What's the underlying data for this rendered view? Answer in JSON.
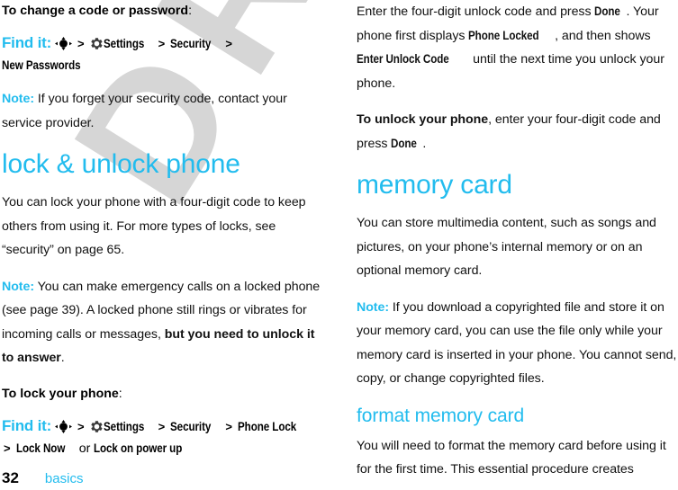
{
  "page": {
    "number": "32",
    "chapter": "basics",
    "watermark": "DRAFT",
    "accent_color": "#22bcee",
    "watermark_color": "#d6d6d6"
  },
  "icons": {
    "nav_key": "navigation-key-icon",
    "settings_gear": "gear-icon"
  },
  "left_column": {
    "lead_change_code": {
      "text": "To change a code or password",
      "punct": ":"
    },
    "find_it_1": {
      "label": "Find it:",
      "sep": ">",
      "items": [
        "Settings",
        "Security",
        "New Passwords"
      ]
    },
    "note_1": {
      "label": "Note:",
      "text": " If you forget your security code, contact your service provider."
    },
    "section_heading": "lock & unlock phone",
    "para_1": "You can lock your phone with a four-digit code to keep others from using it. For more types of locks, see “security” on page 65.",
    "note_2": {
      "label": "Note:",
      "text_1": " You can make emergency calls on a locked phone (see page 39). A locked phone still rings or vibrates for incoming calls or messages, ",
      "bold": "but you need to unlock it to answer",
      "text_2": "."
    },
    "lead_lock_phone": {
      "text": "To lock your phone",
      "punct": ":"
    },
    "find_it_2": {
      "label": "Find it:",
      "sep": ">",
      "items": [
        "Settings",
        "Security",
        "Phone Lock",
        "Lock Now"
      ],
      "or_text": "or ",
      "or_item": "Lock on power up"
    }
  },
  "right_column": {
    "para_enter_code": {
      "t1": "Enter the four-digit unlock code and press ",
      "ui1": "Done",
      "t2": ". Your phone first displays ",
      "ui2": "Phone Locked",
      "t3": ", and then shows ",
      "ui3": "Enter Unlock Code",
      "t4": " until the next time you unlock your phone."
    },
    "para_unlock": {
      "bold": "To unlock your phone",
      "t1": ", enter your four-digit code and press ",
      "ui1": "Done",
      "t2": "."
    },
    "section_heading": "memory card",
    "para_store": "You can store multimedia content, such as songs and pictures, on your phone’s internal memory or on an optional memory card.",
    "note_copyright": {
      "label": "Note:",
      "text": " If you download a copyrighted file and store it on your memory card, you can use the file only while your memory card is inserted in your phone. You cannot send, copy, or change copyrighted files."
    },
    "subsection_heading": "format memory card",
    "para_format": "You will need to format the memory card before using it for the first time. This essential procedure creates"
  }
}
